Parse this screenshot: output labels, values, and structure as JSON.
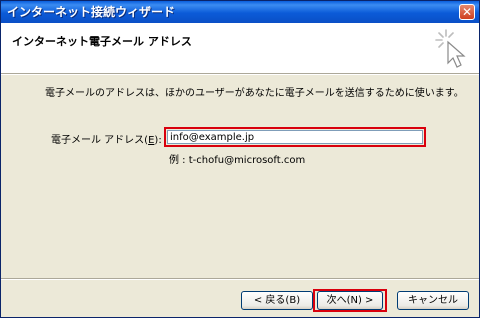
{
  "window": {
    "title": "インターネット接続ウィザード",
    "close_glyph": "✕"
  },
  "header": {
    "title": "インターネット電子メール アドレス",
    "icon": "wizard-icon"
  },
  "description": "電子メールのアドレスは、ほかのユーザーがあなたに電子メールを送信するために使います。",
  "form": {
    "email_label_prefix": "電子メール アドレス(",
    "email_label_key": "E",
    "email_label_suffix": "):",
    "email_value": "info@example.jp",
    "example": "例 : t-chofu@microsoft.com"
  },
  "buttons": {
    "back": "< 戻る(B)",
    "next": "次へ(N) >",
    "cancel": "キャンセル"
  },
  "colors": {
    "highlight_border": "#d9000d",
    "title_bar": "#0a5fdd"
  }
}
